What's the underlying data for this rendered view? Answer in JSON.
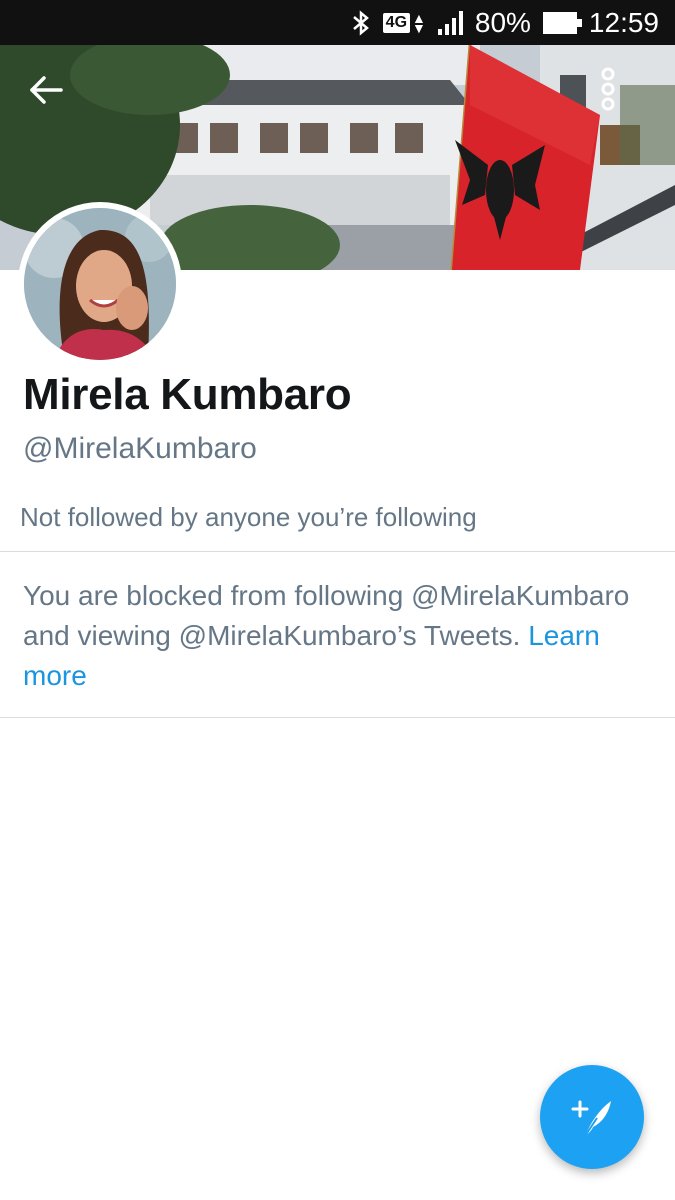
{
  "status_bar": {
    "network": "4G",
    "battery_percent": "80%",
    "time": "12:59",
    "icons": [
      "bluetooth-icon",
      "network-4g-icon",
      "signal-icon",
      "battery-icon"
    ]
  },
  "header": {
    "back_icon": "arrow-left-icon",
    "more_icon": "more-vertical-icon"
  },
  "profile": {
    "display_name": "Mirela Kumbaro",
    "handle": "@MirelaKumbaro",
    "follow_context": "Not followed by anyone you’re following"
  },
  "blocked_notice": {
    "message": "You are blocked from following @MirelaKumbaro and viewing @MirelaKumbaro’s Tweets.",
    "link_label": "Learn more"
  },
  "fab": {
    "icon": "compose-tweet-icon"
  },
  "colors": {
    "accent": "#1da1f2",
    "link": "#1b95e0",
    "text_primary": "#14171a",
    "text_secondary": "#657786",
    "divider": "#d6dce1"
  }
}
